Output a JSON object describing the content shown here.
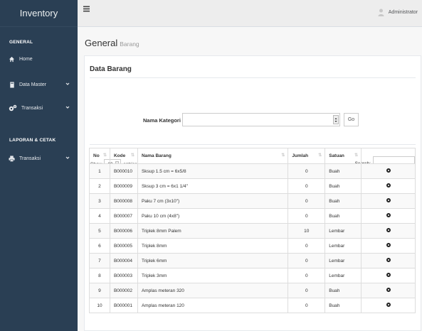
{
  "sidebar": {
    "brand": "Inventory",
    "section_general": "GENERAL",
    "items": [
      {
        "label": "Home"
      },
      {
        "label": "Data Master"
      },
      {
        "label": "Transaksi"
      }
    ],
    "section_report": "LAPORAN & CETAK",
    "report_items": [
      {
        "label": "Transaksi"
      }
    ]
  },
  "topbar": {
    "user": "Administrator"
  },
  "page": {
    "title": "General",
    "subtitle": "Barang"
  },
  "panel": {
    "title": "Data Barang",
    "filter_label": "Nama Kategori",
    "filter_value": "",
    "go_label": "Go",
    "show_prefix": "Show",
    "show_value": "10",
    "show_suffix": "entries",
    "search_label": "Search:",
    "search_value": ""
  },
  "table": {
    "headers": [
      "No",
      "Kode",
      "Nama Barang",
      "Jumlah",
      "Satuan",
      ""
    ],
    "rows": [
      {
        "no": "1",
        "kode": "B000010",
        "nama": "Sksup 1.5 cm = 6x5/8",
        "jumlah": "0",
        "satuan": "Buah"
      },
      {
        "no": "2",
        "kode": "B000009",
        "nama": "Sksup 3 cm = 6x1 1/4\"",
        "jumlah": "0",
        "satuan": "Buah"
      },
      {
        "no": "3",
        "kode": "B000008",
        "nama": "Paku 7 cm (3x10\")",
        "jumlah": "0",
        "satuan": "Buah"
      },
      {
        "no": "4",
        "kode": "B000007",
        "nama": "Paku 10 cm (4x8\")",
        "jumlah": "0",
        "satuan": "Buah"
      },
      {
        "no": "5",
        "kode": "B000006",
        "nama": "Triplek 8mm Palem",
        "jumlah": "10",
        "satuan": "Lembar"
      },
      {
        "no": "6",
        "kode": "B000005",
        "nama": "Triplek 8mm",
        "jumlah": "0",
        "satuan": "Lembar"
      },
      {
        "no": "7",
        "kode": "B000004",
        "nama": "Triplek 6mm",
        "jumlah": "0",
        "satuan": "Lembar"
      },
      {
        "no": "8",
        "kode": "B000003",
        "nama": "Triplek 3mm",
        "jumlah": "0",
        "satuan": "Lembar"
      },
      {
        "no": "9",
        "kode": "B000002",
        "nama": "Amplas meteran 320",
        "jumlah": "0",
        "satuan": "Buah"
      },
      {
        "no": "10",
        "kode": "B000001",
        "nama": "Amplas meteran 120",
        "jumlah": "0",
        "satuan": "Buah"
      }
    ]
  },
  "icons": {
    "home": "home-icon",
    "data_master": "book-icon",
    "transaksi": "gears-icon",
    "report_transaksi": "print-icon",
    "menu": "hamburger-icon",
    "user": "user-icon",
    "view": "eye-icon"
  },
  "colors": {
    "sidebar": "#2a3f54",
    "topbar": "#ededed",
    "content": "#f7f7f7"
  }
}
